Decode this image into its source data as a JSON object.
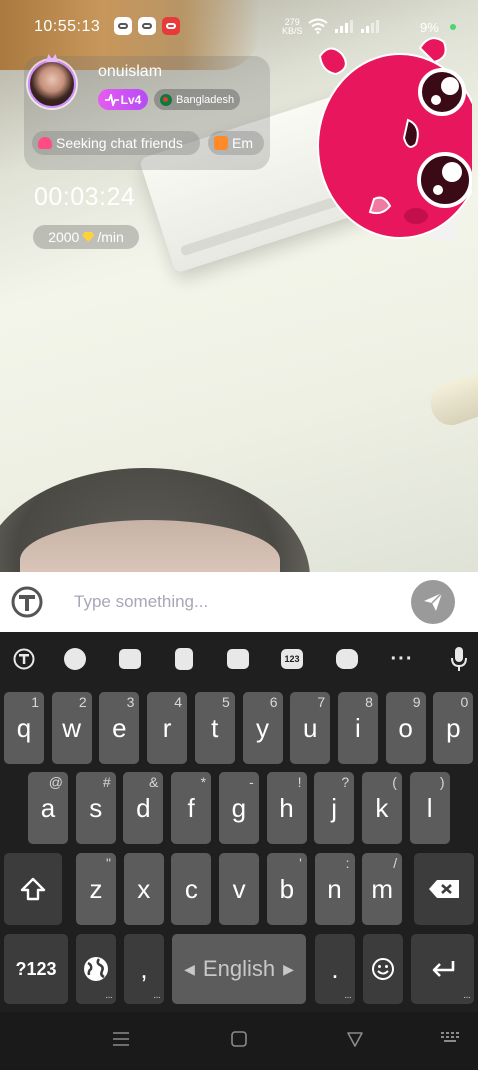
{
  "status_bar": {
    "time": "10:55:13",
    "speed_value": "279",
    "speed_unit": "KB/S",
    "battery": "9%",
    "icons": [
      "game-icon",
      "gallery-icon",
      "video-icon",
      "wifi-icon",
      "signal-icon",
      "battery-icon"
    ]
  },
  "profile": {
    "username": "onuislam",
    "level": "Lv4",
    "country": "Bangladesh",
    "tags": [
      "Seeking chat friends",
      "Em"
    ]
  },
  "call": {
    "timer": "00:03:24",
    "rate_value": "2000",
    "rate_unit": "/min"
  },
  "composer": {
    "placeholder": "Type something..."
  },
  "keyboard": {
    "toolbar_icons": [
      "translate-icon",
      "emoji-icon",
      "store-icon",
      "clipboard-icon",
      "code-icon",
      "numpad-icon",
      "sticker-icon",
      "more-icon",
      "mic-icon"
    ],
    "numpad_label": "123",
    "row1": [
      {
        "key": "q",
        "hint": "1"
      },
      {
        "key": "w",
        "hint": "2"
      },
      {
        "key": "e",
        "hint": "3"
      },
      {
        "key": "r",
        "hint": "4"
      },
      {
        "key": "t",
        "hint": "5"
      },
      {
        "key": "y",
        "hint": "6"
      },
      {
        "key": "u",
        "hint": "7"
      },
      {
        "key": "i",
        "hint": "8"
      },
      {
        "key": "o",
        "hint": "9"
      },
      {
        "key": "p",
        "hint": "0"
      }
    ],
    "row2": [
      {
        "key": "a",
        "hint": "@"
      },
      {
        "key": "s",
        "hint": "#"
      },
      {
        "key": "d",
        "hint": "&"
      },
      {
        "key": "f",
        "hint": "*"
      },
      {
        "key": "g",
        "hint": "-"
      },
      {
        "key": "h",
        "hint": "!"
      },
      {
        "key": "j",
        "hint": "?"
      },
      {
        "key": "k",
        "hint": "("
      },
      {
        "key": "l",
        "hint": ")"
      }
    ],
    "row3": [
      {
        "key": "z",
        "hint": "\""
      },
      {
        "key": "x",
        "hint": ""
      },
      {
        "key": "c",
        "hint": ""
      },
      {
        "key": "v",
        "hint": ""
      },
      {
        "key": "b",
        "hint": "'"
      },
      {
        "key": "n",
        "hint": ":"
      },
      {
        "key": "m",
        "hint": "/"
      }
    ],
    "symbols_label": "?123",
    "comma": ",",
    "space_label": "English",
    "period": "."
  },
  "colors": {
    "level_badge": "#d452f2",
    "sticker": "#e8175d",
    "key": "#5c5c5c",
    "keyboard_bg": "#1f1f1f"
  }
}
